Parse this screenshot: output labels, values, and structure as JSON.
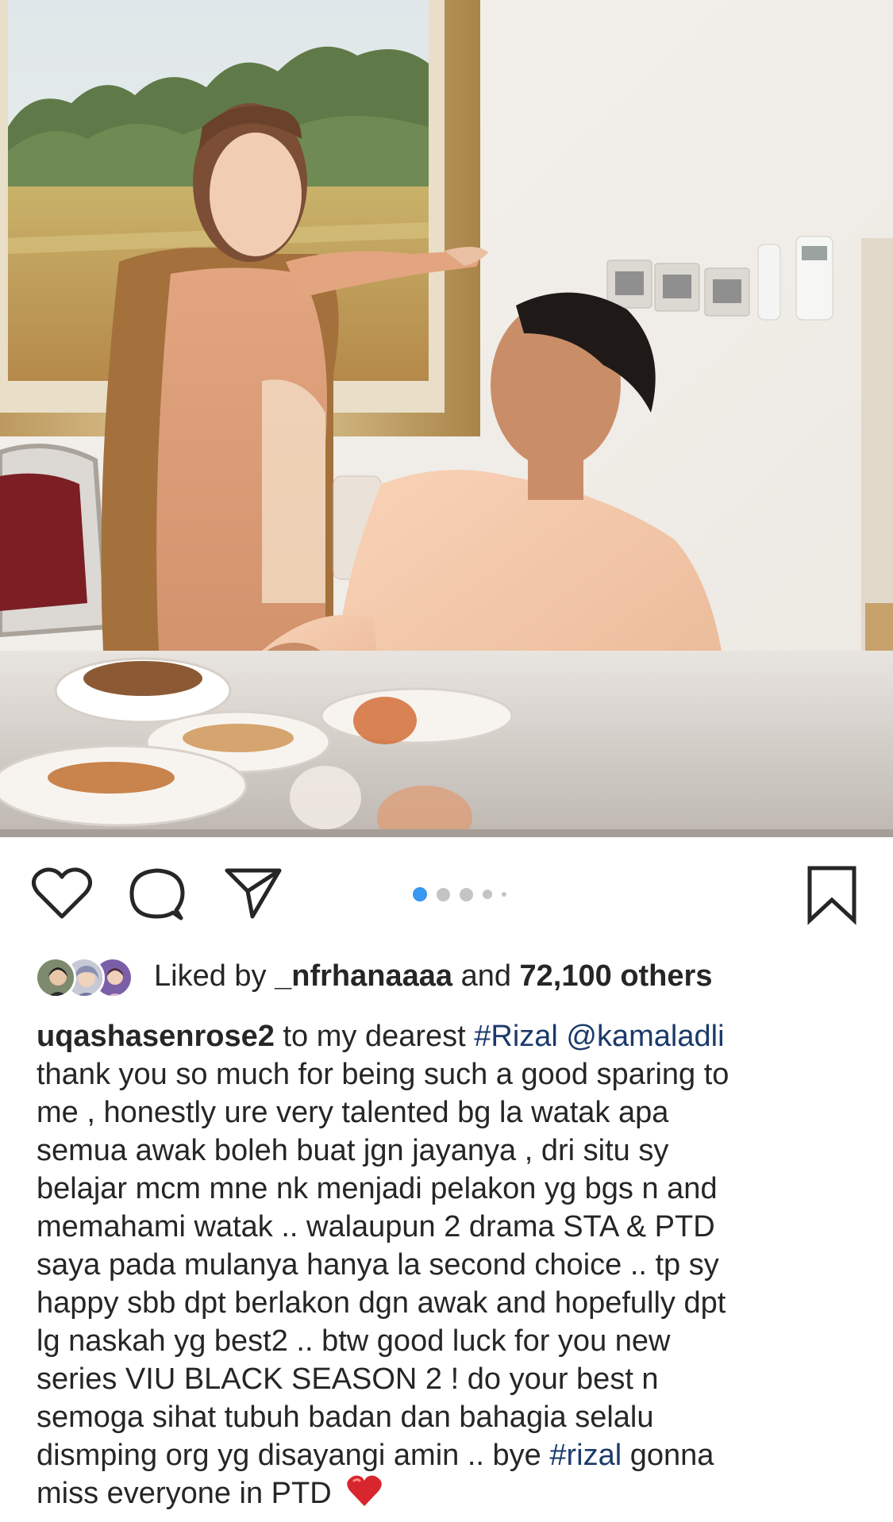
{
  "post": {
    "image_alt": "Photo of a woman in a peach outfit and shawl pointing, and a seated man in a peach baju looking up at her at a dining table",
    "carousel": {
      "total": 5,
      "current": 1
    },
    "liked_by": {
      "prefix": "Liked by",
      "user": "_nfrhanaaaa",
      "connector": "and",
      "others": "72,100 others"
    },
    "caption": {
      "username": "uqashasenrose2",
      "lines": [
        [
          {
            "t": "text",
            "v": " to my dearest "
          },
          {
            "t": "hashtag",
            "v": "#Rizal"
          },
          {
            "t": "text",
            "v": " "
          },
          {
            "t": "mention",
            "v": "@kamaladli"
          }
        ],
        [
          {
            "t": "text",
            "v": "thank you so much for being such a good sparing to"
          }
        ],
        [
          {
            "t": "text",
            "v": "me , honestly ure very talented bg la watak apa"
          }
        ],
        [
          {
            "t": "text",
            "v": "semua awak boleh buat jgn jayanya , dri situ sy"
          }
        ],
        [
          {
            "t": "text",
            "v": "belajar mcm mne nk menjadi pelakon yg bgs n and"
          }
        ],
        [
          {
            "t": "text",
            "v": "memahami watak .. walaupun 2 drama STA & PTD"
          }
        ],
        [
          {
            "t": "text",
            "v": "saya pada mulanya hanya la second choice .. tp sy"
          }
        ],
        [
          {
            "t": "text",
            "v": "happy sbb dpt berlakon dgn awak and hopefully dpt"
          }
        ],
        [
          {
            "t": "text",
            "v": "lg naskah yg best2 .. btw good luck for you new"
          }
        ],
        [
          {
            "t": "text",
            "v": "series VIU BLACK SEASON 2 ! do your best n"
          }
        ],
        [
          {
            "t": "text",
            "v": "semoga sihat tubuh badan dan bahagia selalu"
          }
        ],
        [
          {
            "t": "text",
            "v": "dismping org yg disayangi amin .. bye "
          },
          {
            "t": "hashtag",
            "v": "#rizal"
          },
          {
            "t": "text",
            "v": " gonna"
          }
        ],
        [
          {
            "t": "text",
            "v": "miss everyone in PTD "
          },
          {
            "t": "emoji",
            "v": "red-heart"
          }
        ]
      ]
    }
  },
  "icons": {
    "like": "heart-outline-icon",
    "comment": "comment-bubble-icon",
    "share": "paper-plane-icon",
    "save": "bookmark-outline-icon"
  },
  "colors": {
    "text": "#262626",
    "link": "#1b3a6b",
    "dot_active": "#3897f0",
    "dot_inactive": "#c4c4c4",
    "heart_emoji": "#d7262d"
  }
}
